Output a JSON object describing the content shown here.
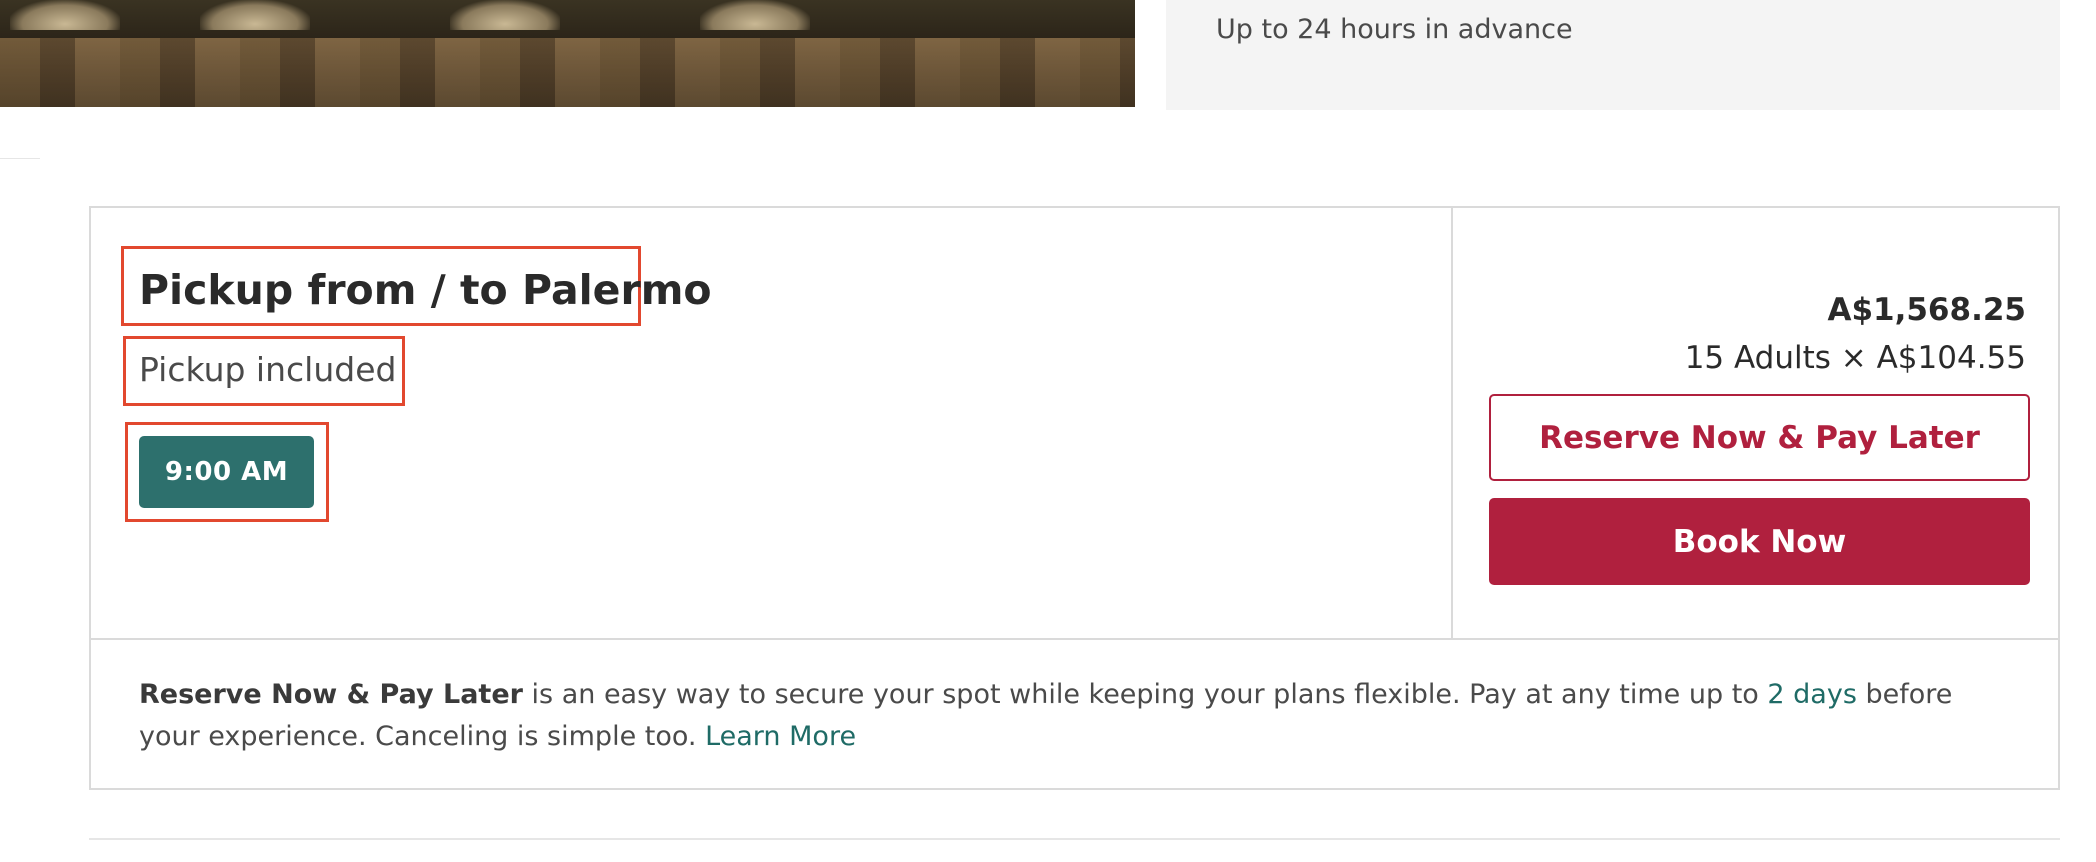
{
  "info_card": {
    "text": "Up to 24 hours in advance"
  },
  "option": {
    "title": "Pickup from / to Palermo",
    "pickup": "Pickup included",
    "time_slot": "9:00 AM",
    "price_total": "A$1,568.25",
    "price_breakdown": "15 Adults × A$104.55",
    "reserve_label": "Reserve Now & Pay Later",
    "book_label": "Book Now"
  },
  "reserve_info": {
    "strong": "Reserve Now & Pay Later",
    "text_1": " is an easy way to secure your spot while keeping your plans flexible. Pay at any time up to ",
    "days": "2 days",
    "text_2": " before your experience. Canceling is simple too. ",
    "link": "Learn More"
  },
  "colors": {
    "teal": "#2d706d",
    "crimson": "#b0203e",
    "highlight": "#e2482f"
  }
}
